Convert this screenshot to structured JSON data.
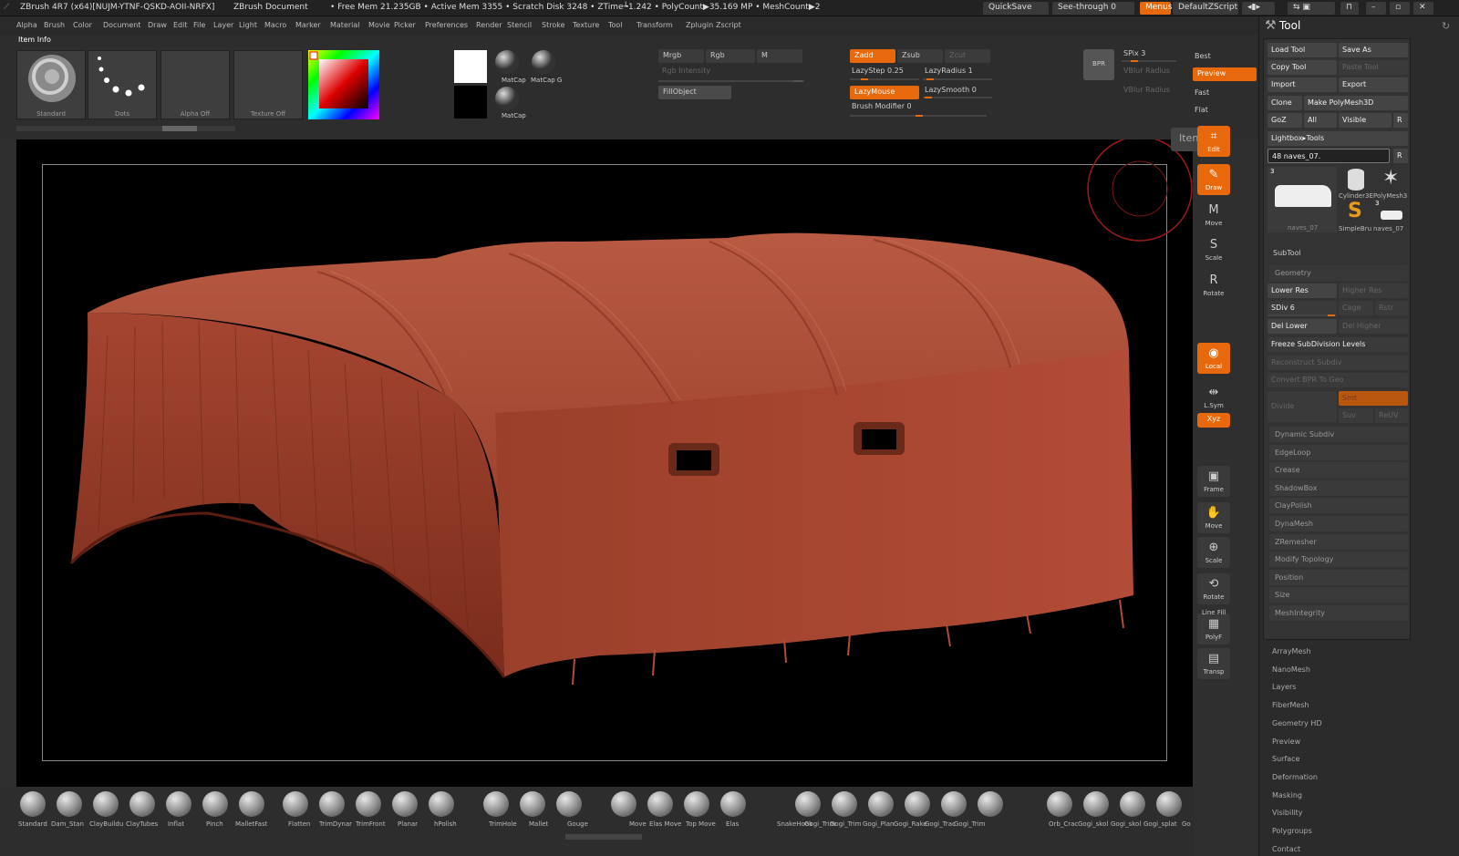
{
  "title": {
    "app": "ZBrush 4R7 (x64)[NUJM-YTNF-QSKD-AOII-NRFX]",
    "doc": "ZBrush Document",
    "stats": "• Free Mem 21.235GB • Active Mem 3355 • Scratch Disk 3248 • ZTime┶1.242 • PolyCount▶35.169 MP • MeshCount▶2",
    "quicksave": "QuickSave",
    "seethrough": "See-through  0",
    "menus": "Menus",
    "script": "DefaultZScript"
  },
  "menus": [
    "Alpha",
    "Brush",
    "Color",
    "Document",
    "Draw",
    "Edit",
    "File",
    "Layer",
    "Light",
    "Macro",
    "Marker",
    "Material",
    "Movie",
    "Picker",
    "Preferences",
    "Render",
    "Stencil",
    "Stroke",
    "Texture",
    "Tool",
    "Transform",
    "Zplugin",
    "Zscript"
  ],
  "shelf": {
    "item_info": "Item Info",
    "swatches": [
      "Standard",
      "Dots",
      "Alpha  Off",
      "Texture  Off"
    ],
    "matcap1": "MatCap",
    "matcap2": "MatCap  G",
    "matcap3": "MatCap",
    "mrgb": "Mrgb",
    "rgb": "Rgb",
    "m": "M",
    "rgb_intensity": "Rgb  Intensity",
    "fillobject": "FillObject",
    "zadd": "Zadd",
    "zsub": "Zsub",
    "zcut": "Zcut",
    "lazystep": "LazyStep 0.25",
    "lazyradius": "LazyRadius 1",
    "lazymouse": "LazyMouse",
    "lazysmooth": "LazySmooth 0",
    "brush_modifier": "Brush Modifier 0",
    "bpr": "BPR",
    "spix": "SPix 3",
    "vblur_radius1": "VBlur Radius",
    "vblur_radius2": "VBlur Radius",
    "best": "Best",
    "preview": "Preview",
    "fast": "Fast",
    "flat": "Flat"
  },
  "right_tools": [
    {
      "name": "Edit",
      "active": true
    },
    {
      "name": "Draw",
      "active": true
    },
    {
      "name": "Move",
      "active": false
    },
    {
      "name": "Scale",
      "active": false
    },
    {
      "name": "Rotate",
      "active": false
    },
    {
      "name": "Local",
      "active": true
    },
    {
      "name": "L.Sym",
      "active": false
    },
    {
      "name": "Xyz",
      "active": true
    },
    {
      "name": "Frame",
      "active": false
    },
    {
      "name": "Move",
      "active": false
    },
    {
      "name": "Scale",
      "active": false
    },
    {
      "name": "Rotate",
      "active": false
    },
    {
      "name": "PolyF",
      "active": false
    },
    {
      "name": "Transp",
      "active": false
    }
  ],
  "line_fill": "Line Fill",
  "item_tooltip": "Iten",
  "tool_panel": {
    "title": "Tool",
    "load_tool": "Load Tool",
    "save_as": "Save As",
    "copy_tool": "Copy Tool",
    "paste_tool": "Paste Tool",
    "import": "Import",
    "export": "Export",
    "clone": "Clone",
    "make_polymesh": "Make PolyMesh3D",
    "goz": "GoZ",
    "all": "All",
    "visible": "Visible",
    "r": "R",
    "lightbox_tools": "Lightbox▸Tools",
    "current_tool": "48 naves_07.",
    "r2": "R",
    "thumb_count1": "3",
    "thumb_count2": "3",
    "thumbs": [
      "naves_07",
      "Cylinder3E",
      "PolyMesh3",
      "SimpleBru",
      "naves_07"
    ],
    "subtool": "SubTool",
    "geometry": "Geometry",
    "lower_res": "Lower Res",
    "higher_res": "Higher Res",
    "sdiv": "SDiv 6",
    "cage": "Cage",
    "rstr": "Rstr",
    "del_lower": "Del Lower",
    "del_higher": "Del Higher",
    "freeze": "Freeze SubDivision Levels",
    "reconstruct": "Reconstruct Subdiv",
    "convert_bpr": "Convert BPR To Geo",
    "divide": "Divide",
    "smt": "Smt",
    "suv": "Suv",
    "reuv": "ReUV",
    "sections": [
      "Dynamic Subdiv",
      "EdgeLoop",
      "Crease",
      "ShadowBox",
      "ClayPolish",
      "DynaMesh",
      "ZRemesher",
      "Modify Topology",
      "Position",
      "Size",
      "MeshIntegrity"
    ],
    "more": [
      "ArrayMesh",
      "NanoMesh",
      "Layers",
      "FiberMesh",
      "Geometry HD",
      "Preview",
      "Surface",
      "Deformation",
      "Masking",
      "Visibility",
      "Polygroups",
      "Contact"
    ]
  },
  "brushes": [
    "Standard",
    "Dam_Stan",
    "ClayBuildu",
    "ClayTubes",
    "Inflat",
    "Pinch",
    "MalletFast",
    "Flatten",
    "TrimDynar",
    "TrimFront",
    "Planar",
    "hPolish",
    "TrimHole",
    "Mallet",
    "Gouge",
    "Move",
    "Elas Move",
    "Top Move",
    "Elas",
    "SnakeHook",
    "Gogi_Trim",
    "Gogi_Trim",
    "Gogi_Plan",
    "Gogi_Rake",
    "Gogi_Trac",
    "Gogi_Trim",
    "Orb_Crac",
    "Gogi_skol",
    "Gogi_skol",
    "Gogi_splat",
    "Go"
  ],
  "colors": {
    "accent": "#e8690c",
    "mesh": "#a4432e",
    "canvas": "#000000"
  }
}
